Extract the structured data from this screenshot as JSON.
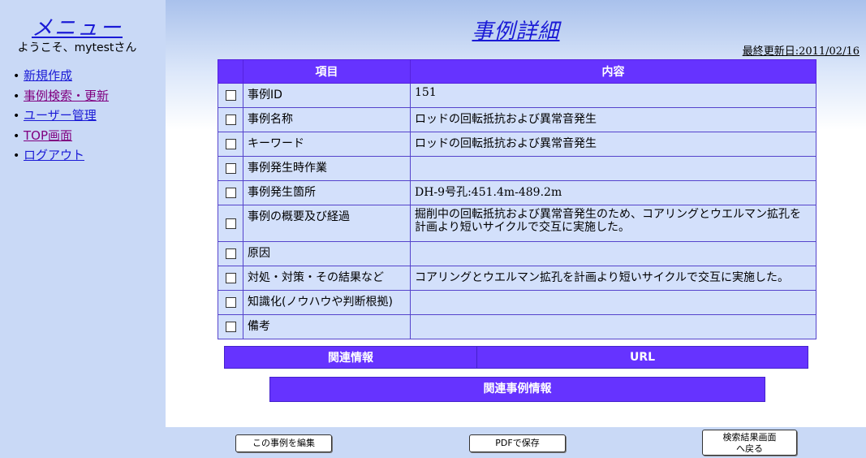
{
  "sidebar": {
    "title": "メニュー",
    "welcome": "ようこそ、mytestさん",
    "items": [
      {
        "label": "新規作成"
      },
      {
        "label": "事例検索・更新"
      },
      {
        "label": "ユーザー管理"
      },
      {
        "label": "TOP画面"
      },
      {
        "label": "ログアウト"
      }
    ]
  },
  "main": {
    "title": "事例詳細",
    "last_updated": "最終更新日:2011/02/16",
    "table": {
      "headers": [
        "項目",
        "内容"
      ],
      "rows": [
        {
          "item": "事例ID",
          "content": "151"
        },
        {
          "item": "事例名称",
          "content": "ロッドの回転抵抗および異常音発生"
        },
        {
          "item": "キーワード",
          "content": "ロッドの回転抵抗および異常音発生"
        },
        {
          "item": "事例発生時作業",
          "content": ""
        },
        {
          "item": "事例発生箇所",
          "content": "DH-9号孔:451.4m-489.2m"
        },
        {
          "item": "事例の概要及び経過",
          "content": "掘削中の回転抵抗および異常音発生のため、コアリングとウエルマン拡孔を計画より短いサイクルで交互に実施した。"
        },
        {
          "item": "原因",
          "content": ""
        },
        {
          "item": "対処・対策・その結果など",
          "content": "コアリングとウエルマン拡孔を計画より短いサイクルで交互に実施した。"
        },
        {
          "item": "知識化(ノウハウや判断根拠)",
          "content": ""
        },
        {
          "item": "備考",
          "content": ""
        }
      ]
    },
    "related": {
      "headers": [
        "関連情報",
        "URL"
      ],
      "related_cases": "関連事例情報"
    }
  },
  "buttons": {
    "edit": "この事例を編集",
    "pdf": "PDFで保存",
    "back_line1": "検索結果画面",
    "back_line2": "へ戻る"
  },
  "colors": {
    "header_bg": "#6633ff",
    "row_bg": "#d3e0fb",
    "link": "#1a1ad6",
    "visited": "#800080"
  }
}
